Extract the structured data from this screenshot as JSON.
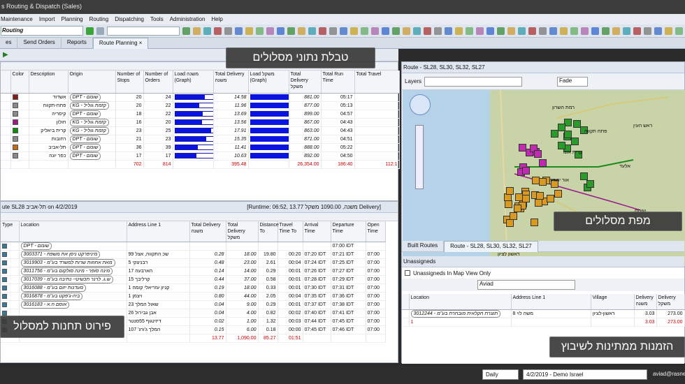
{
  "app": {
    "title": "s Routing & Dispatch (Sales)"
  },
  "menu": [
    "Maintenance",
    "Import",
    "Planning",
    "Routing",
    "Dispatching",
    "Tools",
    "Administration",
    "Help"
  ],
  "toolbar": {
    "routing": "Routing"
  },
  "tabs": [
    "es",
    "Send Orders",
    "Reports",
    "Route Planning"
  ],
  "topPanel": {
    "header": "",
    "columns": [
      "Color",
      "Description",
      "Origin",
      "Number of Stops",
      "Number of Orders",
      "Load משנה (Graph)",
      "Total Delivery משנה",
      "Load משקל (Graph)",
      "Total Delivery משקל",
      "Total Run Time",
      "Total Travel"
    ],
    "rows": [
      {
        "color": "#8a1a1a",
        "desc": "אשדוד",
        "origin": "DPT - שומם",
        "stops": "20",
        "orders": "24",
        "load": 0.78,
        "d1": "14.58",
        "d2": "881.00",
        "run": "05:17"
      },
      {
        "color": "#8a8a8a",
        "desc": "פתח-תקווה",
        "origin": "KG - קזמת גוליל",
        "stops": "20",
        "orders": "22",
        "load": 0.64,
        "d1": "11.96",
        "d2": "877.00",
        "run": "05:13"
      },
      {
        "color": "#8a8a8a",
        "desc": "קיסריה",
        "origin": "DPT - שומם",
        "stops": "18",
        "orders": "22",
        "load": 0.73,
        "d1": "13.69",
        "d2": "899.00",
        "run": "04:57"
      },
      {
        "color": "#9a1a8a",
        "desc": "חולון",
        "origin": "KG - קזמת גוליל",
        "stops": "16",
        "orders": "20",
        "load": 0.72,
        "d1": "13.56",
        "d2": "867.00",
        "run": "04:43"
      },
      {
        "color": "#0f8a0f",
        "desc": "קרית ביאליק",
        "origin": "KG - קזמת גוליל",
        "stops": "23",
        "orders": "25",
        "load": 0.96,
        "d1": "17.91",
        "d2": "863.00",
        "run": "04:43"
      },
      {
        "color": "#8a8a8a",
        "desc": "רחובות",
        "origin": "DPT - שומם",
        "stops": "21",
        "orders": "23",
        "load": 0.82,
        "d1": "15.35",
        "d2": "871.00",
        "run": "04:51"
      },
      {
        "color": "#c46a10",
        "desc": "תל-אביב",
        "origin": "DPT - שומם",
        "stops": "36",
        "orders": "39",
        "load": 0.61,
        "d1": "11.41",
        "d2": "888.00",
        "run": "05:22"
      },
      {
        "color": "#8a8a8a",
        "desc": "כפר יונה",
        "origin": "DPT - שומם",
        "stops": "17",
        "orders": "17",
        "load": 0.57,
        "d1": "10.63",
        "d2": "892.00",
        "run": "04:50"
      }
    ],
    "totals": {
      "stops": "702",
      "orders": "814",
      "d1": "395.48",
      "d2": "26,354.00",
      "run": "186:40",
      "travel": "112:1"
    }
  },
  "bottomPanel": {
    "header": "ute SL28 תל-אביב on 4/2/2019",
    "runtime": "[Runtime: 06:52, 13.77 משנה, 1090.00 משקל Delivery]",
    "columns": [
      "Type",
      "Location",
      "Address Line 1",
      "Total Delivery משנה",
      "Total Delivery משקל",
      "Distance To",
      "Travel Time To",
      "Arrival Time",
      "Departure Time",
      "Open Time"
    ],
    "rows": [
      {
        "loc": "DPT - שומם",
        "addr": "",
        "d1": "",
        "d2": "",
        "dist": "",
        "tt": "",
        "arr": "",
        "dep": "07:00 IDT",
        "open": ""
      },
      {
        "loc": "3003371 - מיניפרקט ניסן את משפח",
        "addr": "שכ התקווה, אצל 99",
        "d1": "0.28",
        "d2": "18.00",
        "dist": "19.80",
        "tt": "00:20",
        "arr": "07:20 IDT",
        "dep": "07:21 IDT",
        "open": "07:00"
      },
      {
        "loc": "3019903 - מאת אחוזות שרות למשרד בע\"מ",
        "addr": "רבניצקי 5",
        "d1": "0.48",
        "d2": "23.00",
        "dist": "2.61",
        "tt": "00:04",
        "arr": "07:24 IDT",
        "dep": "07:25 IDT",
        "open": "07:00"
      },
      {
        "loc": "3011756 - מינה סופר - מינה סולקום בע\"מ",
        "addr": "הארבעה 17",
        "d1": "0.14",
        "d2": "14.00",
        "dist": "0.29",
        "tt": "00:01",
        "arr": "07:26 IDT",
        "dep": "07:27 IDT",
        "open": "07:00"
      },
      {
        "loc": "3017039 - ש.ג. לרנר תכשיטי- נתיבה בע\"מ",
        "addr": "קרליבך 15",
        "d1": "0.44",
        "d2": "37.00",
        "dist": "0.58",
        "tt": "00:01",
        "arr": "07:28 IDT",
        "dep": "07:29 IDT",
        "open": "07:00"
      },
      {
        "loc": "3016088 - מעדנות יזום בע\"מ",
        "addr": "קניון עזריאלי קומה 1",
        "d1": "0.19",
        "d2": "18.00",
        "dist": "0.33",
        "tt": "00:01",
        "arr": "07:30 IDT",
        "dep": "07:31 IDT",
        "open": "07:00"
      },
      {
        "loc": "3016878 - ביה-ג'פקט בע\"מ",
        "addr": "ויצמן 1",
        "d1": "0.80",
        "d2": "44.00",
        "dist": "2.05",
        "tt": "00:04",
        "arr": "07:35 IDT",
        "dep": "07:36 IDT",
        "open": "07:00"
      },
      {
        "loc": "3016183 - אוסם ח.א",
        "addr": "שאול המלך 23",
        "d1": "0.04",
        "d2": "9.00",
        "dist": "0.29",
        "tt": "00:01",
        "arr": "07:37 IDT",
        "dep": "07:38 IDT",
        "open": "07:00"
      },
      {
        "loc": "",
        "addr": "אבן גבירול 26",
        "d1": "0.04",
        "d2": "4.00",
        "dist": "0.82",
        "tt": "00:02",
        "arr": "07:40 IDT",
        "dep": "07:41 IDT",
        "open": "07:00"
      },
      {
        "loc": "",
        "addr": "דיזינגוף 55סנטר",
        "d1": "0.02",
        "d2": "1.00",
        "dist": "1.32",
        "tt": "00:03",
        "arr": "07:44 IDT",
        "dep": "07:45 IDT",
        "open": "07:00"
      },
      {
        "loc": "",
        "addr": "המלך ג'ורג' 107",
        "d1": "0.15",
        "d2": "6.00",
        "dist": "0.18",
        "tt": "00:00",
        "arr": "07:45 IDT",
        "dep": "07:46 IDT",
        "open": "07:00"
      }
    ],
    "totals": {
      "d1": "13.77",
      "d2": "1,090.00",
      "dist": "85.27",
      "tt": "01:51"
    }
  },
  "map": {
    "header": "Route - SL28, SL30, SL32, SL27",
    "layers": "Layers",
    "mode": "Fade",
    "labels": [
      "רמת השרון",
      "פתח תקווה",
      "ראש העין",
      "קרית אונו",
      "אלעד",
      "אור יהודה",
      "ראשון לציון",
      "שוהם"
    ],
    "tabs": [
      "Built Routes",
      "Route - SL28, SL30, SL32, SL27"
    ]
  },
  "unassigned": {
    "header": "Unassigneds",
    "checkbox": "Unassigneds In Map View Only",
    "filter": "Aviad",
    "columns": [
      "Location",
      "Address Line 1",
      "Village",
      "Delivery משנה",
      "Delivery משקל"
    ],
    "row": {
      "loc": "3012244 - תוצרת חקלאית מובחרת בע\"מ",
      "addr": "משה לוי 8",
      "village": "ראשון-לציון",
      "d1": "3.03",
      "d2": "273.00"
    },
    "totals": {
      "count": "1",
      "d1": "3.03",
      "d2": "273.00"
    }
  },
  "callouts": {
    "table": "טבלת נתוני מסלולים",
    "map": "מפת מסלולים",
    "stops": "פירוט תחנות למסלול",
    "pending": "הזמנות ממתינות לשיבוץ"
  },
  "status": {
    "period": "Daily",
    "date": "4/2/2019 - Demo Israel",
    "user": "aviad@rasne"
  }
}
